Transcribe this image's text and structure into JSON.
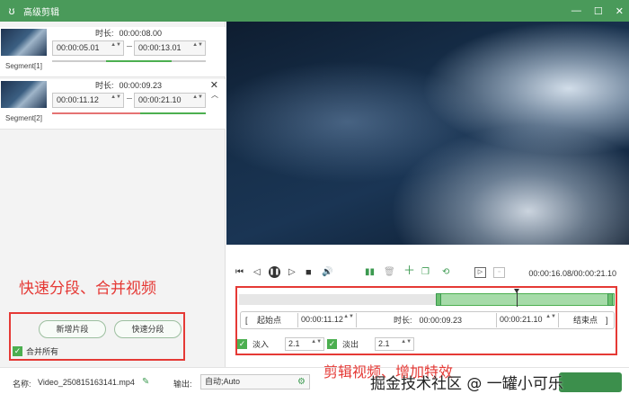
{
  "window": {
    "title": "高级剪辑",
    "min_glyph": "—",
    "max_glyph": "☐",
    "close_glyph": "✕"
  },
  "segments": [
    {
      "label": "Segment[1]",
      "duration_label": "时长:",
      "duration": "00:00:08.00",
      "start": "00:00:05.01",
      "end": "00:00:13.01"
    },
    {
      "label": "Segment[2]",
      "duration_label": "时长:",
      "duration": "00:00:09.23",
      "start": "00:00:11.12",
      "end": "00:00:21.10"
    }
  ],
  "left_panel": {
    "annotation": "快速分段、合并视频",
    "add_segment_label": "新增片段",
    "quick_split_label": "快速分段",
    "merge_all_label": "合并所有"
  },
  "player": {
    "time_readout": "00:00:16.08/00:00:21.10"
  },
  "range": {
    "start_label": "起始点",
    "start_value": "00:00:11.12",
    "duration_label": "时长:",
    "duration_value": "00:00:09.23",
    "end_value": "00:00:21.10",
    "end_label": "结束点",
    "bracket_left": "[",
    "bracket_right": "]"
  },
  "fade": {
    "in_label": "淡入",
    "in_value": "2.1",
    "out_label": "淡出",
    "out_value": "2.1"
  },
  "bottom": {
    "annotation": "剪辑视频、增加特效",
    "name_label": "名称:",
    "name_value": "Video_250815163141.mp4",
    "output_label": "输出:",
    "output_value": "自动;Auto",
    "watermark": "掘金技术社区 @ 一罐小可乐"
  },
  "icons": {
    "check": "✓",
    "spin": "▲▼",
    "close_glyph": "✕",
    "expand_glyph": "︿"
  },
  "colors": {
    "accent": "#4a9a5a",
    "annotation_red": "#e53935",
    "range_fill": "#a6dba9"
  }
}
